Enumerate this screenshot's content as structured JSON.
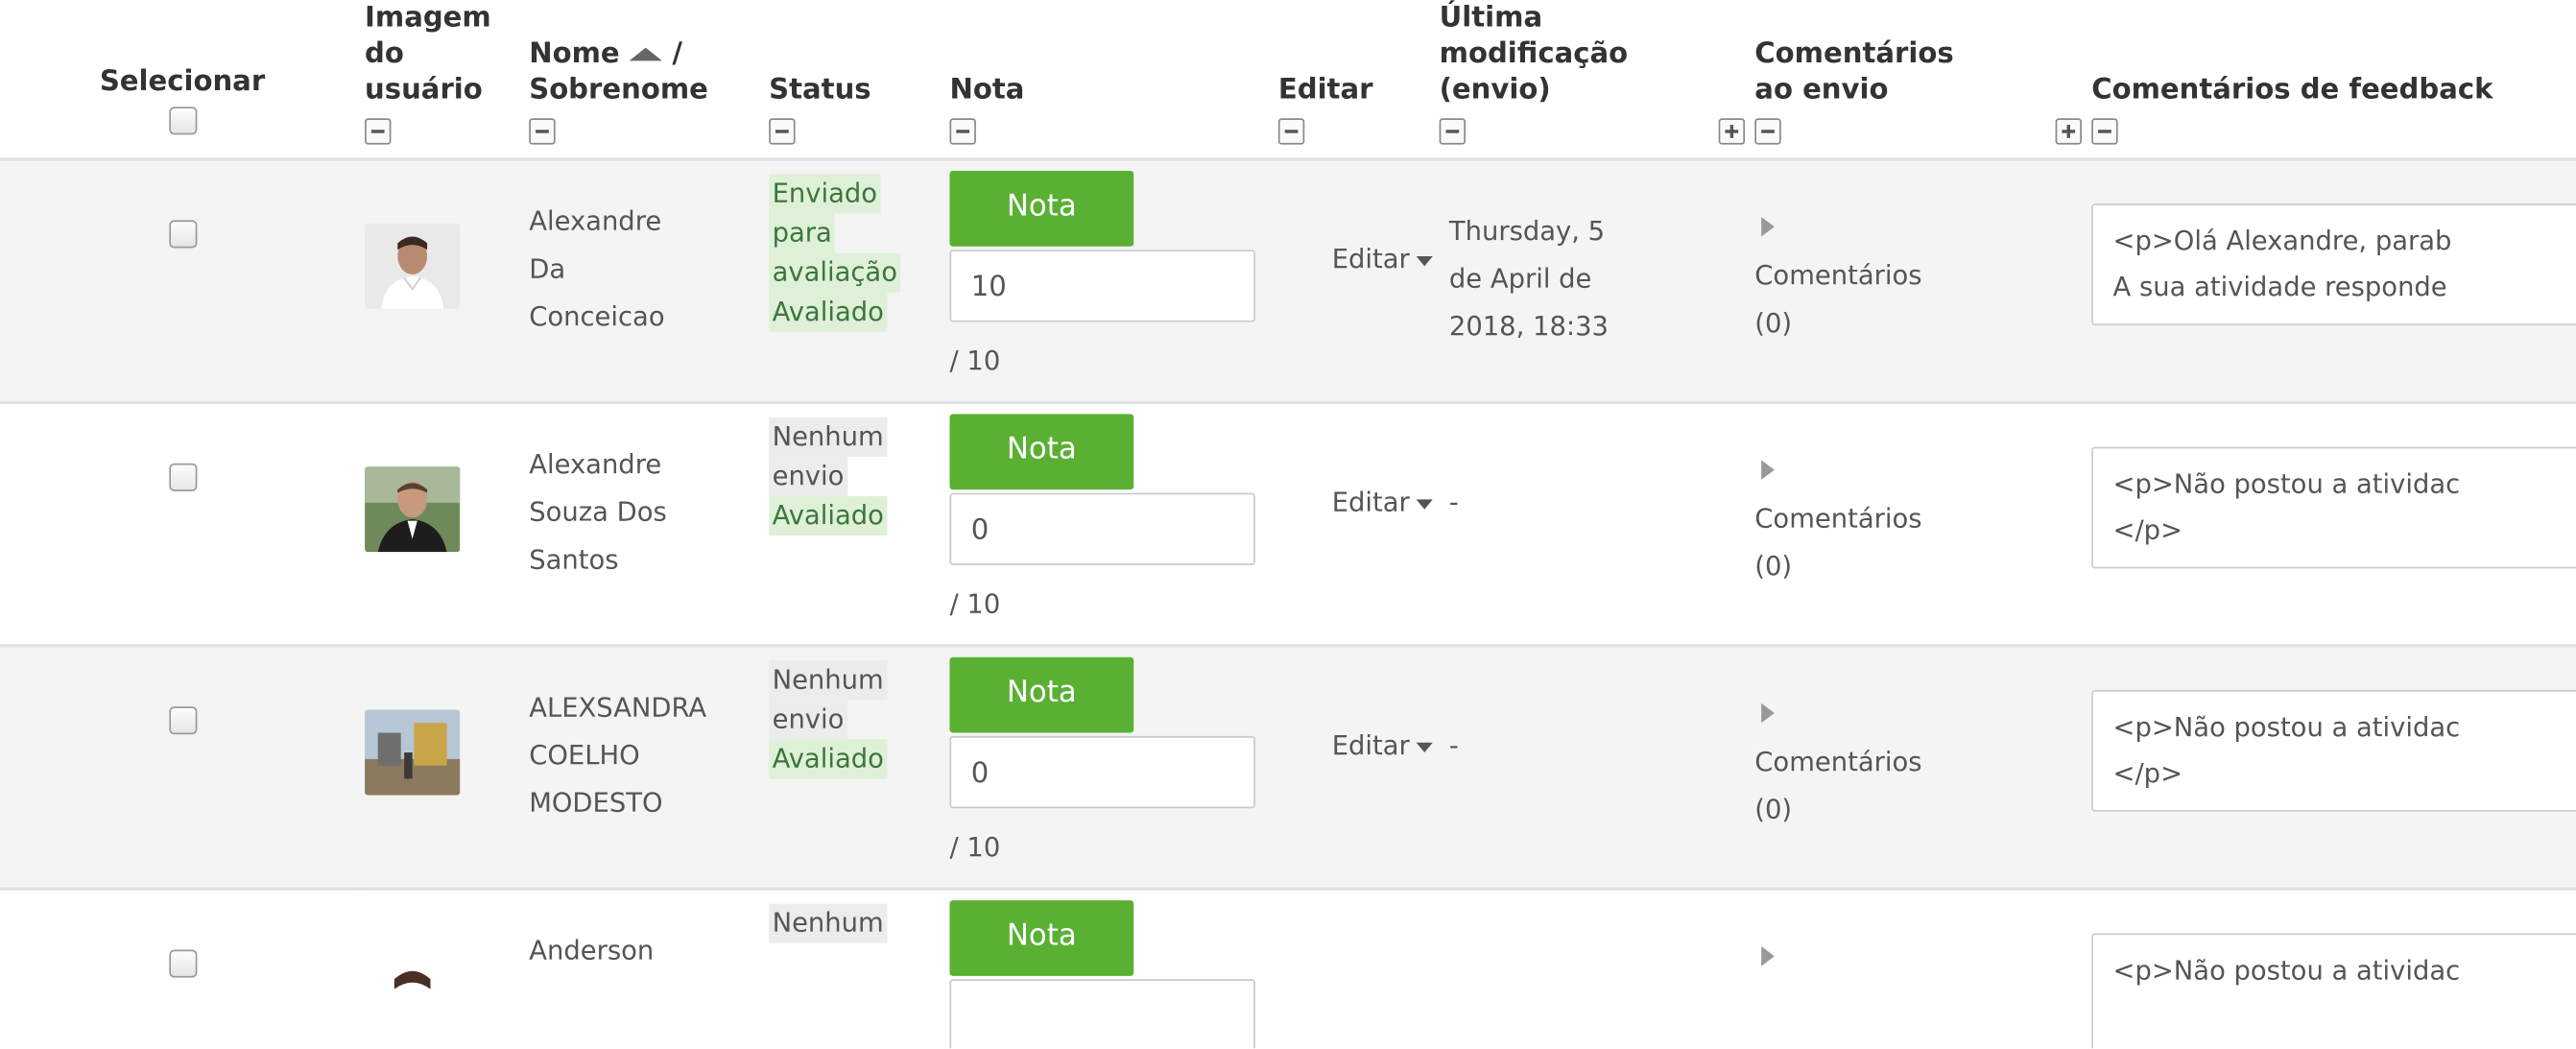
{
  "headers": {
    "select": "Selecionar",
    "image": [
      "Imagem",
      "do",
      "usuário"
    ],
    "name_first": "Nome",
    "name_sep": "/",
    "name_last": "Sobrenome",
    "status": "Status",
    "grade": "Nota",
    "edit": "Editar",
    "last_modified": [
      "Última",
      "modificação",
      "(envio)"
    ],
    "submission_comments": [
      "Comentários",
      "ao envio"
    ],
    "feedback_comments": "Comentários de feedback"
  },
  "rows": [
    {
      "name_lines": [
        "Alexandre",
        "Da",
        "Conceicao"
      ],
      "status_lines": [
        "Enviado",
        "para",
        "avaliação"
      ],
      "status_graded": "Avaliado",
      "grade_button": "Nota",
      "grade_value": "10",
      "grade_max": "/ 10",
      "edit_label": "Editar",
      "modified_lines": [
        "Thursday, 5",
        "de April de",
        "2018, 18:33"
      ],
      "comments_label": "Comentários",
      "comments_count": "(0)",
      "feedback_text": "<p>Olá Alexandre, parab\nA sua atividade responde"
    },
    {
      "name_lines": [
        "Alexandre",
        "Souza Dos",
        "Santos"
      ],
      "status_lines": [
        "Nenhum",
        "envio"
      ],
      "status_graded": "Avaliado",
      "grade_button": "Nota",
      "grade_value": "0",
      "grade_max": "/ 10",
      "edit_label": "Editar",
      "modified": "-",
      "comments_label": "Comentários",
      "comments_count": "(0)",
      "feedback_text": "<p>Não postou a atividac\n</p>"
    },
    {
      "name_lines": [
        "ALEXSANDRA",
        "COELHO",
        "MODESTO"
      ],
      "status_lines": [
        "Nenhum",
        "envio"
      ],
      "status_graded": "Avaliado",
      "grade_button": "Nota",
      "grade_value": "0",
      "grade_max": "/ 10",
      "edit_label": "Editar",
      "modified": "-",
      "comments_label": "Comentários",
      "comments_count": "(0)",
      "feedback_text": "<p>Não postou a atividac\n</p>"
    },
    {
      "name_lines": [
        "Anderson"
      ],
      "status_lines": [
        "Nenhum"
      ],
      "grade_button": "Nota",
      "feedback_text": "<p>Não postou a atividac"
    }
  ]
}
